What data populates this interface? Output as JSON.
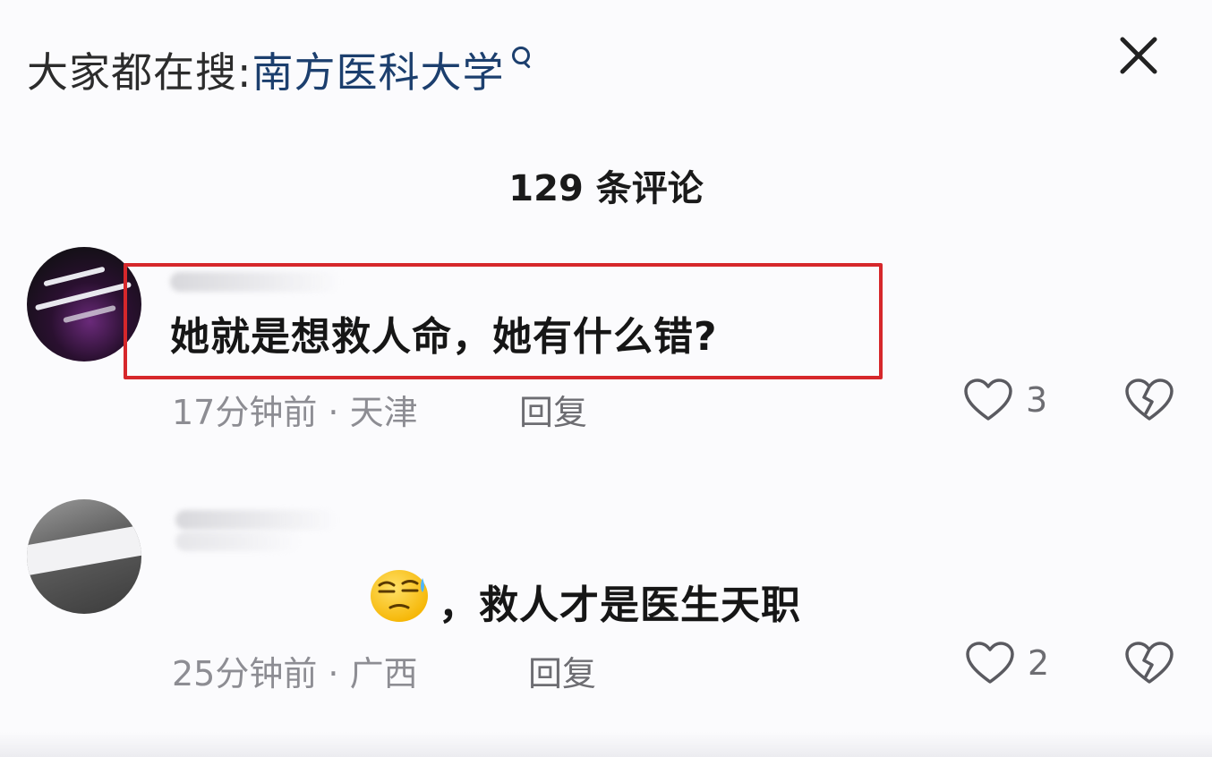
{
  "search_hint": {
    "prefix": "大家都在搜:",
    "keyword": "南方医科大学"
  },
  "header": {
    "comment_count": "129 条评论"
  },
  "comments": [
    {
      "text": "她就是想救人命，她有什么错?",
      "time_location": "17分钟前 · 天津",
      "reply_label": "回复",
      "likes": "3",
      "highlighted": true
    },
    {
      "text_suffix": "，救人才是医生天职",
      "emoji": "tearful-wry-face-emoji",
      "time_location": "25分钟前 · 广西",
      "reply_label": "回复",
      "likes": "2",
      "highlighted": false
    }
  ],
  "icons": {
    "close": "close-icon",
    "search": "search-icon",
    "like": "heart-outline-icon",
    "dislike": "broken-heart-icon"
  },
  "colors": {
    "background": "#fbfbfd",
    "keyword": "#1c3f6e",
    "highlight_border": "#d6272b",
    "meta_text": "#8d8d93"
  }
}
